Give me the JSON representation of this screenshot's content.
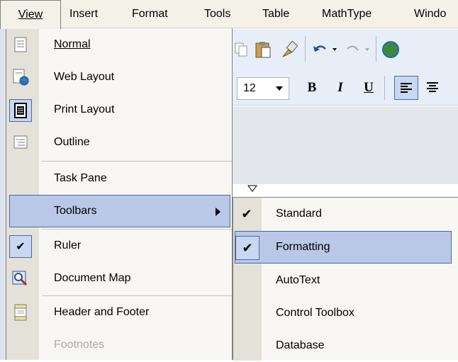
{
  "menubar": {
    "items": [
      "View",
      "Insert",
      "Format",
      "Tools",
      "Table",
      "MathType",
      "Windo"
    ]
  },
  "toolbar": {
    "font_size": "12",
    "bold": "B",
    "italic": "I",
    "underline": "U"
  },
  "view_menu": {
    "items": [
      {
        "label": "Normal",
        "icon": "normal-view-icon"
      },
      {
        "label": "Web Layout",
        "icon": "web-layout-icon"
      },
      {
        "label": "Print Layout",
        "icon": "print-layout-icon",
        "checked_style": true
      },
      {
        "label": "Outline",
        "icon": "outline-view-icon"
      },
      {
        "label": "Task Pane"
      },
      {
        "label": "Toolbars",
        "highlighted": true,
        "has_submenu": true
      },
      {
        "label": "Ruler",
        "checked": true
      },
      {
        "label": "Document Map",
        "icon": "document-map-icon"
      },
      {
        "label": "Header and Footer",
        "icon": "header-footer-icon"
      },
      {
        "label": "Footnotes",
        "disabled": true
      }
    ]
  },
  "toolbars_submenu": {
    "items": [
      {
        "label": "Standard",
        "checked": true
      },
      {
        "label": "Formatting",
        "checked": true,
        "highlighted": true
      },
      {
        "label": "AutoText"
      },
      {
        "label": "Control Toolbox"
      },
      {
        "label": "Database"
      }
    ]
  },
  "colors": {
    "highlight": "#b8c8e6",
    "highlight_border": "#4668a8",
    "menu_bg": "#f8f7f3",
    "gutter": "#e4e2d8"
  }
}
